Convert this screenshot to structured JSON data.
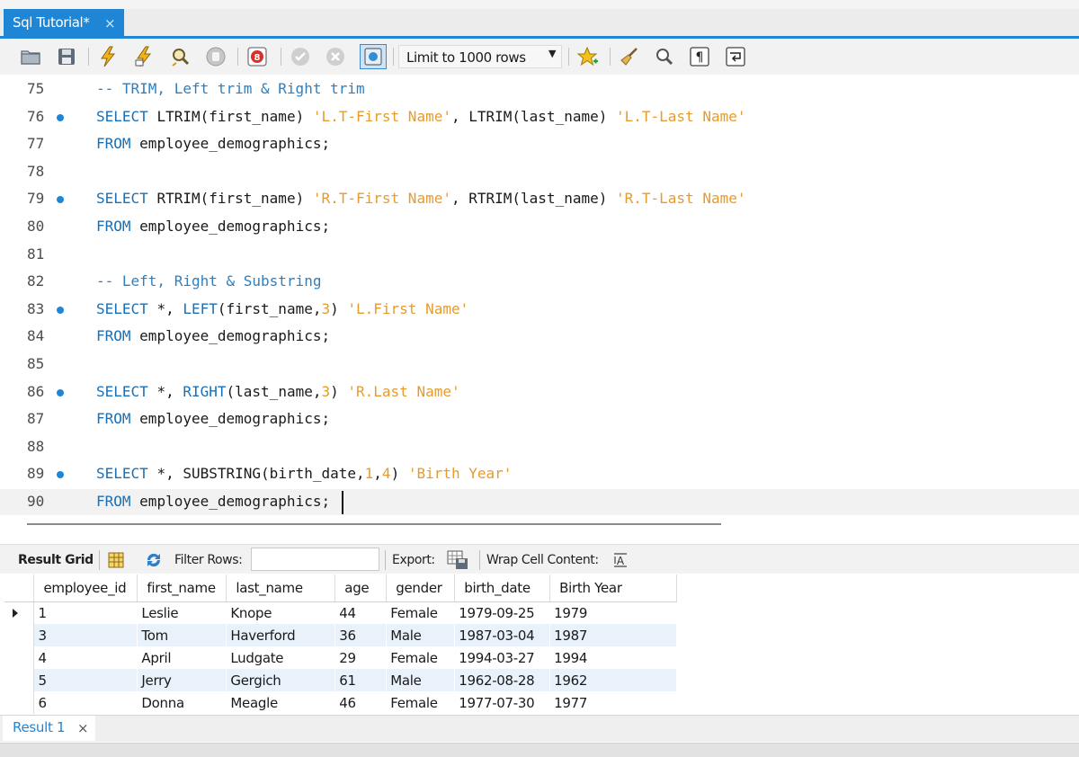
{
  "tab": {
    "title": "Sql Tutorial*",
    "close": "×"
  },
  "toolbar": {
    "limit_select": "Limit to 1000 rows",
    "icons": [
      "folder-icon",
      "save-icon",
      "execute-icon",
      "execute-current-icon",
      "explain-icon",
      "stop-icon",
      "error-toggle-icon",
      "commit-icon",
      "rollback-icon",
      "autocommit-icon",
      "star-icon",
      "beautify-icon",
      "find-icon",
      "invisible-chars-icon",
      "wrap-icon"
    ]
  },
  "editor": {
    "lines": [
      {
        "num": "75",
        "bp": false
      },
      {
        "num": "76",
        "bp": true
      },
      {
        "num": "77",
        "bp": false
      },
      {
        "num": "78",
        "bp": false
      },
      {
        "num": "79",
        "bp": true
      },
      {
        "num": "80",
        "bp": false
      },
      {
        "num": "81",
        "bp": false
      },
      {
        "num": "82",
        "bp": false
      },
      {
        "num": "83",
        "bp": true
      },
      {
        "num": "84",
        "bp": false
      },
      {
        "num": "85",
        "bp": false
      },
      {
        "num": "86",
        "bp": true
      },
      {
        "num": "87",
        "bp": false
      },
      {
        "num": "88",
        "bp": false
      },
      {
        "num": "89",
        "bp": true
      },
      {
        "num": "90",
        "bp": false
      }
    ],
    "code": [
      [
        {
          "t": "-- TRIM, Left trim & Right trim",
          "c": "cm"
        }
      ],
      [
        {
          "t": "SELECT ",
          "c": "kw"
        },
        {
          "t": "LTRIM",
          "c": "fn"
        },
        {
          "t": "(first_name) ",
          "c": "fn"
        },
        {
          "t": "'L.T-First Name'",
          "c": "st"
        },
        {
          "t": ", ",
          "c": "fn"
        },
        {
          "t": "LTRIM",
          "c": "fn"
        },
        {
          "t": "(last_name) ",
          "c": "fn"
        },
        {
          "t": "'L.T-Last Name'",
          "c": "st"
        }
      ],
      [
        {
          "t": "FROM ",
          "c": "kw"
        },
        {
          "t": "employee_demographics;",
          "c": "fn"
        }
      ],
      [],
      [
        {
          "t": "SELECT ",
          "c": "kw"
        },
        {
          "t": "RTRIM",
          "c": "fn"
        },
        {
          "t": "(first_name) ",
          "c": "fn"
        },
        {
          "t": "'R.T-First Name'",
          "c": "st"
        },
        {
          "t": ", ",
          "c": "fn"
        },
        {
          "t": "RTRIM",
          "c": "fn"
        },
        {
          "t": "(last_name) ",
          "c": "fn"
        },
        {
          "t": "'R.T-Last Name'",
          "c": "st"
        }
      ],
      [
        {
          "t": "FROM ",
          "c": "kw"
        },
        {
          "t": "employee_demographics;",
          "c": "fn"
        }
      ],
      [],
      [
        {
          "t": "-- Left, Right & Substring",
          "c": "cm"
        }
      ],
      [
        {
          "t": "SELECT ",
          "c": "kw"
        },
        {
          "t": "*, ",
          "c": "fn"
        },
        {
          "t": "LEFT",
          "c": "kw"
        },
        {
          "t": "(first_name,",
          "c": "fn"
        },
        {
          "t": "3",
          "c": "nu"
        },
        {
          "t": ") ",
          "c": "fn"
        },
        {
          "t": "'L.First Name'",
          "c": "st"
        }
      ],
      [
        {
          "t": "FROM ",
          "c": "kw"
        },
        {
          "t": "employee_demographics;",
          "c": "fn"
        }
      ],
      [],
      [
        {
          "t": "SELECT ",
          "c": "kw"
        },
        {
          "t": "*, ",
          "c": "fn"
        },
        {
          "t": "RIGHT",
          "c": "kw"
        },
        {
          "t": "(last_name,",
          "c": "fn"
        },
        {
          "t": "3",
          "c": "nu"
        },
        {
          "t": ") ",
          "c": "fn"
        },
        {
          "t": "'R.Last Name'",
          "c": "st"
        }
      ],
      [
        {
          "t": "FROM ",
          "c": "kw"
        },
        {
          "t": "employee_demographics;",
          "c": "fn"
        }
      ],
      [],
      [
        {
          "t": "SELECT ",
          "c": "kw"
        },
        {
          "t": "*, ",
          "c": "fn"
        },
        {
          "t": "SUBSTRING",
          "c": "fn"
        },
        {
          "t": "(birth_date,",
          "c": "fn"
        },
        {
          "t": "1",
          "c": "nu"
        },
        {
          "t": ",",
          "c": "fn"
        },
        {
          "t": "4",
          "c": "nu"
        },
        {
          "t": ") ",
          "c": "fn"
        },
        {
          "t": "'Birth Year'",
          "c": "st"
        }
      ],
      [
        {
          "t": "FROM ",
          "c": "kw"
        },
        {
          "t": "employee_demographics;",
          "c": "fn"
        }
      ]
    ]
  },
  "result": {
    "grid_label": "Result Grid",
    "filter_label": "Filter Rows:",
    "filter_value": "",
    "export_label": "Export:",
    "wrap_label": "Wrap Cell Content:",
    "columns": [
      "employee_id",
      "first_name",
      "last_name",
      "age",
      "gender",
      "birth_date",
      "Birth Year"
    ],
    "rows": [
      [
        "1",
        "Leslie",
        "Knope",
        "44",
        "Female",
        "1979-09-25",
        "1979"
      ],
      [
        "3",
        "Tom",
        "Haverford",
        "36",
        "Male",
        "1987-03-04",
        "1987"
      ],
      [
        "4",
        "April",
        "Ludgate",
        "29",
        "Female",
        "1994-03-27",
        "1994"
      ],
      [
        "5",
        "Jerry",
        "Gergich",
        "61",
        "Male",
        "1962-08-28",
        "1962"
      ],
      [
        "6",
        "Donna",
        "Meagle",
        "46",
        "Female",
        "1977-07-30",
        "1977"
      ]
    ]
  },
  "bottom": {
    "result_tab": "Result 1",
    "close": "×"
  },
  "colors": {
    "accent": "#1f86d6",
    "keyword": "#1a6fb5",
    "string": "#e59b2d",
    "comment": "#2f7fbf",
    "breakpoint": "#1f86d6",
    "row_alt": "#e9f1fb"
  }
}
